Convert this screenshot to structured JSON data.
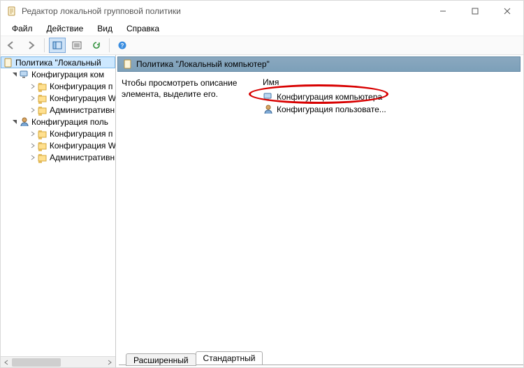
{
  "window": {
    "title": "Редактор локальной групповой политики"
  },
  "menu": {
    "file": "Файл",
    "action": "Действие",
    "view": "Вид",
    "help": "Справка"
  },
  "tree": {
    "root": "Политика \"Локальный",
    "cfg_computer": "Конфигурация ком",
    "cfg_program_c": "Конфигурация п",
    "cfg_windows_c": "Конфигурация W",
    "admin_c": "Административн",
    "cfg_user": "Конфигурация поль",
    "cfg_program_u": "Конфигурация п",
    "cfg_windows_u": "Конфигурация W",
    "admin_u": "Административн"
  },
  "right": {
    "header": "Политика \"Локальный компьютер\"",
    "desc_l1": "Чтобы просмотреть описание",
    "desc_l2": "элемента, выделите его.",
    "col_name": "Имя",
    "items": [
      {
        "label": "Конфигурация компьютера"
      },
      {
        "label": "Конфигурация пользовате..."
      }
    ]
  },
  "tabs": {
    "extended": "Расширенный",
    "standard": "Стандартный"
  }
}
